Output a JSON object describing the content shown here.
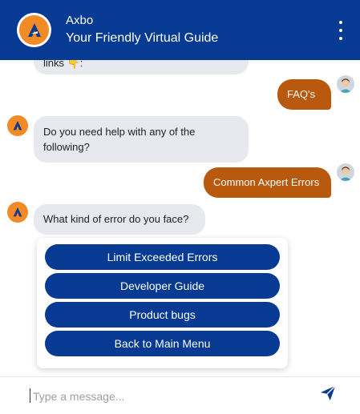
{
  "header": {
    "title": "Axbo",
    "subtitle": "Your Friendly Virtual Guide",
    "logo_icon": "axbo-logo-icon",
    "menu_icon": "more-vertical-icon"
  },
  "messages": {
    "bot_partial": "links 👇:",
    "user_faq": "FAQ's",
    "bot_help": "Do you need help with any of the following?",
    "user_errors": "Common Axpert Errors",
    "bot_error_type": "What kind of error do you face?"
  },
  "options": [
    {
      "label": "Limit Exceeded Errors"
    },
    {
      "label": "Developer Guide"
    },
    {
      "label": "Product bugs"
    },
    {
      "label": "Back to Main Menu"
    }
  ],
  "composer": {
    "placeholder": "Type a message...",
    "send_icon": "send-icon"
  },
  "colors": {
    "brand": "#063a93",
    "user_bubble": "#b9590d",
    "bot_bubble": "#e7e9ee",
    "logo_accent": "#f28a25"
  }
}
